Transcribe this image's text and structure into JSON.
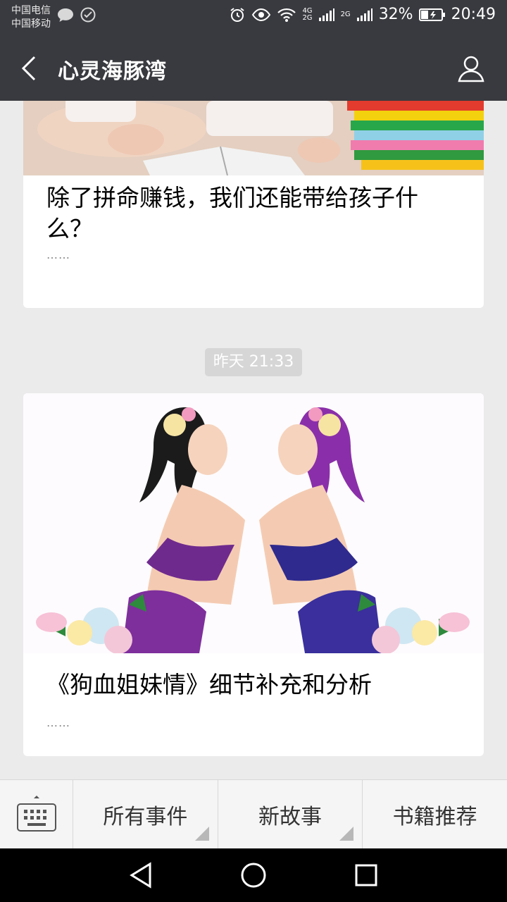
{
  "status_bar": {
    "carrier_1": "中国电信",
    "carrier_2": "中国移动",
    "network_1": "4G",
    "network_1b": "2G",
    "network_2": "2G",
    "battery": "32%",
    "time": "20:49"
  },
  "header": {
    "title": "心灵海豚湾"
  },
  "articles": [
    {
      "title": "除了拼命赚钱，我们还能带给孩子什么？",
      "digest": "……"
    },
    {
      "title": "《狗血姐妹情》细节补充和分析",
      "digest": "……"
    }
  ],
  "timestamp": "昨天 21:33",
  "menu": {
    "items": [
      "所有事件",
      "新故事",
      "书籍推荐"
    ]
  },
  "colors": {
    "topbar": "#393a3f",
    "background": "#ebebeb",
    "card": "#ffffff"
  },
  "icons": [
    "back-icon",
    "profile-icon",
    "keyboard-icon",
    "nav-back-icon",
    "nav-home-icon",
    "nav-recents-icon"
  ]
}
